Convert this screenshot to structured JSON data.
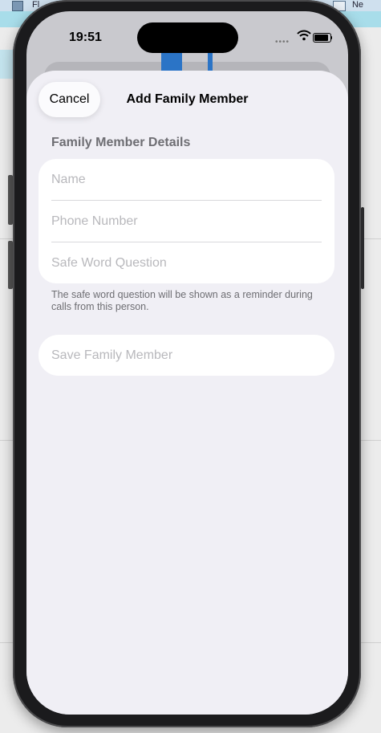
{
  "desktop": {
    "title_fragment": "Fl",
    "right_fragment": "Ne"
  },
  "status_bar": {
    "time": "19:51",
    "signal": "••••"
  },
  "sheet": {
    "cancel_label": "Cancel",
    "title": "Add Family Member",
    "section_header": "Family Member Details",
    "fields": {
      "name_placeholder": "Name",
      "phone_placeholder": "Phone Number",
      "safe_word_placeholder": "Safe Word Question"
    },
    "footnote": "The safe word question will be shown as a reminder during calls from this person.",
    "save_label": "Save Family Member"
  },
  "colors": {
    "sheet_background": "#f0eff5",
    "placeholder_text": "#b8b8bc",
    "secondary_text": "#6e6e73"
  }
}
